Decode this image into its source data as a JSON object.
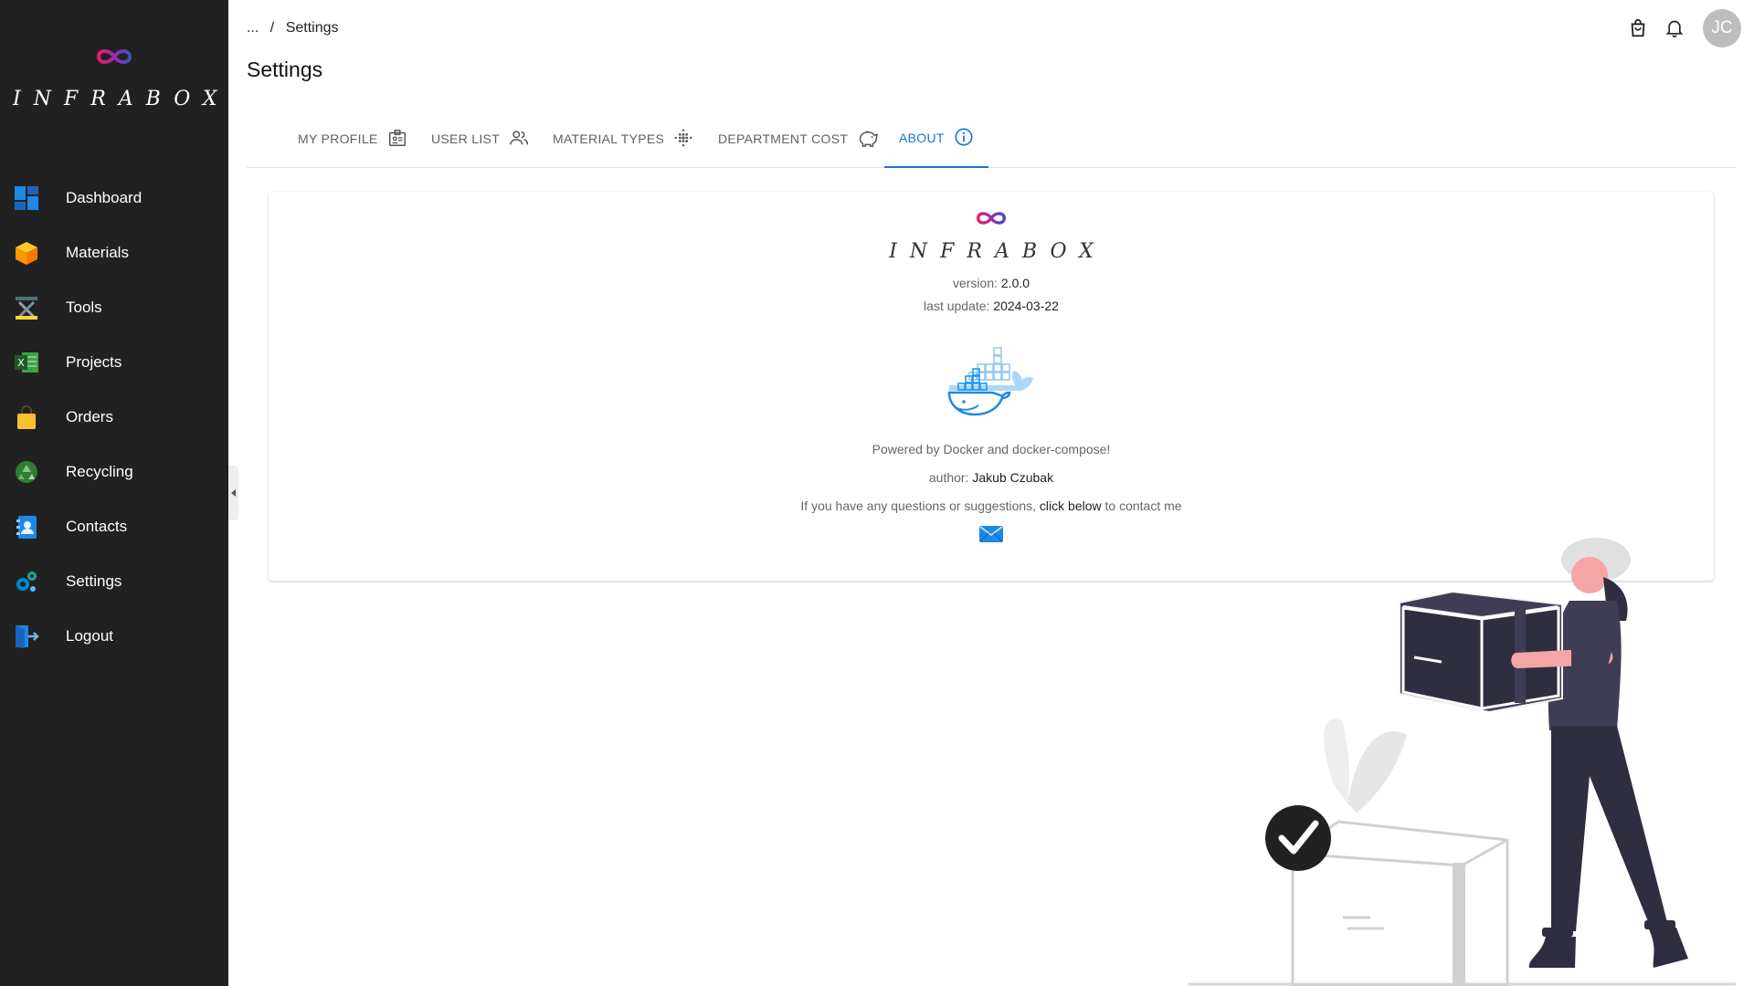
{
  "app": {
    "brand": "INFRABOX"
  },
  "sidebar": {
    "items": [
      {
        "label": "Dashboard",
        "icon": "dashboard-icon"
      },
      {
        "label": "Materials",
        "icon": "box-icon"
      },
      {
        "label": "Tools",
        "icon": "tools-icon"
      },
      {
        "label": "Projects",
        "icon": "excel-icon"
      },
      {
        "label": "Orders",
        "icon": "shopping-bag-icon"
      },
      {
        "label": "Recycling",
        "icon": "recycle-icon"
      },
      {
        "label": "Contacts",
        "icon": "contact-book-icon"
      },
      {
        "label": "Settings",
        "icon": "gears-icon"
      },
      {
        "label": "Logout",
        "icon": "logout-icon"
      }
    ]
  },
  "header": {
    "breadcrumb": {
      "ellipsis": "...",
      "separator": "/",
      "current": "Settings"
    },
    "title": "Settings",
    "avatar_initials": "JC"
  },
  "tabs": [
    {
      "label": "MY PROFILE",
      "icon": "id-card-icon"
    },
    {
      "label": "USER LIST",
      "icon": "users-icon"
    },
    {
      "label": "MATERIAL TYPES",
      "icon": "grid-dots-icon"
    },
    {
      "label": "DEPARTMENT COST",
      "icon": "piggy-bank-icon"
    },
    {
      "label": "ABOUT",
      "icon": "info-icon",
      "active": true
    }
  ],
  "about": {
    "brand": "INFRABOX",
    "version_label": "version:",
    "version": "2.0.0",
    "last_update_label": "last update:",
    "last_update": "2024-03-22",
    "powered_by": "Powered by Docker and docker-compose!",
    "author_label": "author:",
    "author": "Jakub Czubak",
    "contact_prefix": "If you have any questions or suggestions,",
    "contact_link": "click below",
    "contact_suffix": "to contact me"
  },
  "colors": {
    "sidebar_bg": "#212121",
    "accent": "#1976d2",
    "avatar_bg": "#bdbdbd"
  }
}
